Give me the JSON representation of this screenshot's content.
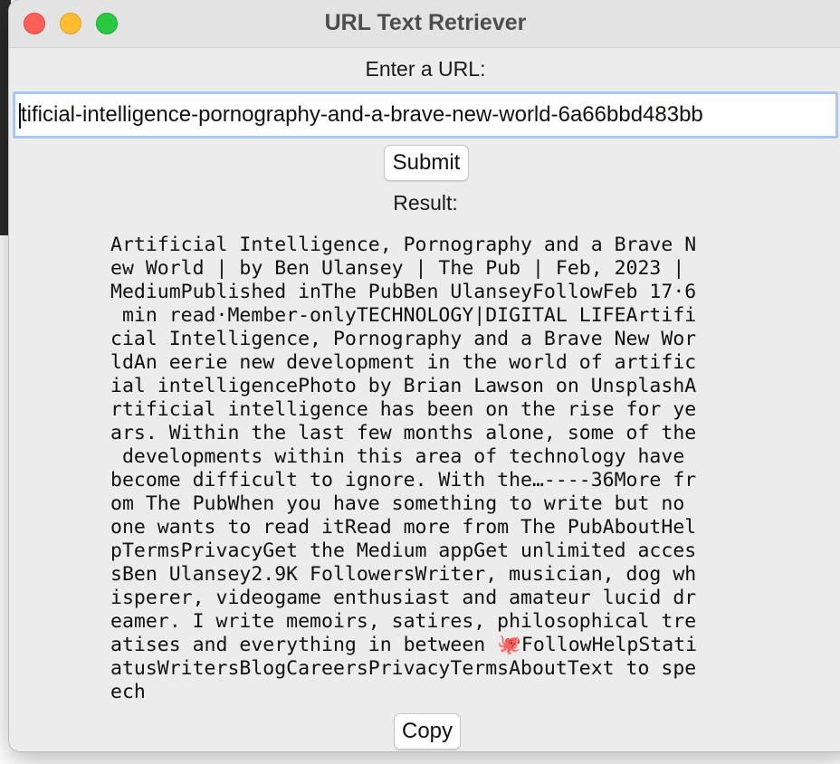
{
  "window": {
    "title": "URL Text Retriever"
  },
  "form": {
    "url_label": "Enter a URL:",
    "url_value": "tificial-intelligence-pornography-and-a-brave-new-world-6a66bbd483bb",
    "submit_label": "Submit",
    "result_label": "Result:",
    "copy_label": "Copy"
  },
  "result": {
    "lines": [
      "Artificial Intelligence, Pornography and a Brave N",
      "ew World | by Ben Ulansey | The Pub | Feb, 2023 |",
      "MediumPublished inThe PubBen UlanseyFollowFeb 17·6",
      " min read·Member-onlyTECHNOLOGY|DIGITAL LIFEArtifi",
      "cial Intelligence, Pornography and a Brave New Wor",
      "ldAn eerie new development in the world of artific",
      "ial intelligencePhoto by Brian Lawson on UnsplashA",
      "rtificial intelligence has been on the rise for ye",
      "ars. Within the last few months alone, some of the",
      " developments within this area of technology have",
      "become difficult to ignore. With the…----36More fr",
      "om The PubWhen you have something to write but no",
      "one wants to read itRead more from The PubAboutHel",
      "pTermsPrivacyGet the Medium appGet unlimited acces",
      "sBen Ulansey2.9K FollowersWriter, musician, dog wh",
      "isperer, videogame enthusiast and amateur lucid dr",
      "eamer. I write memoirs, satires, philosophical tre",
      "atises and everything in between 🐙FollowHelpStati",
      "atusWritersBlogCareersPrivacyTermsAboutText to spe",
      "ech"
    ]
  },
  "colors": {
    "close": "#fe5f57",
    "minimize": "#febc2e",
    "maximize": "#28c840",
    "focus_ring": "#a8c9ef",
    "window_bg": "#ececec"
  }
}
